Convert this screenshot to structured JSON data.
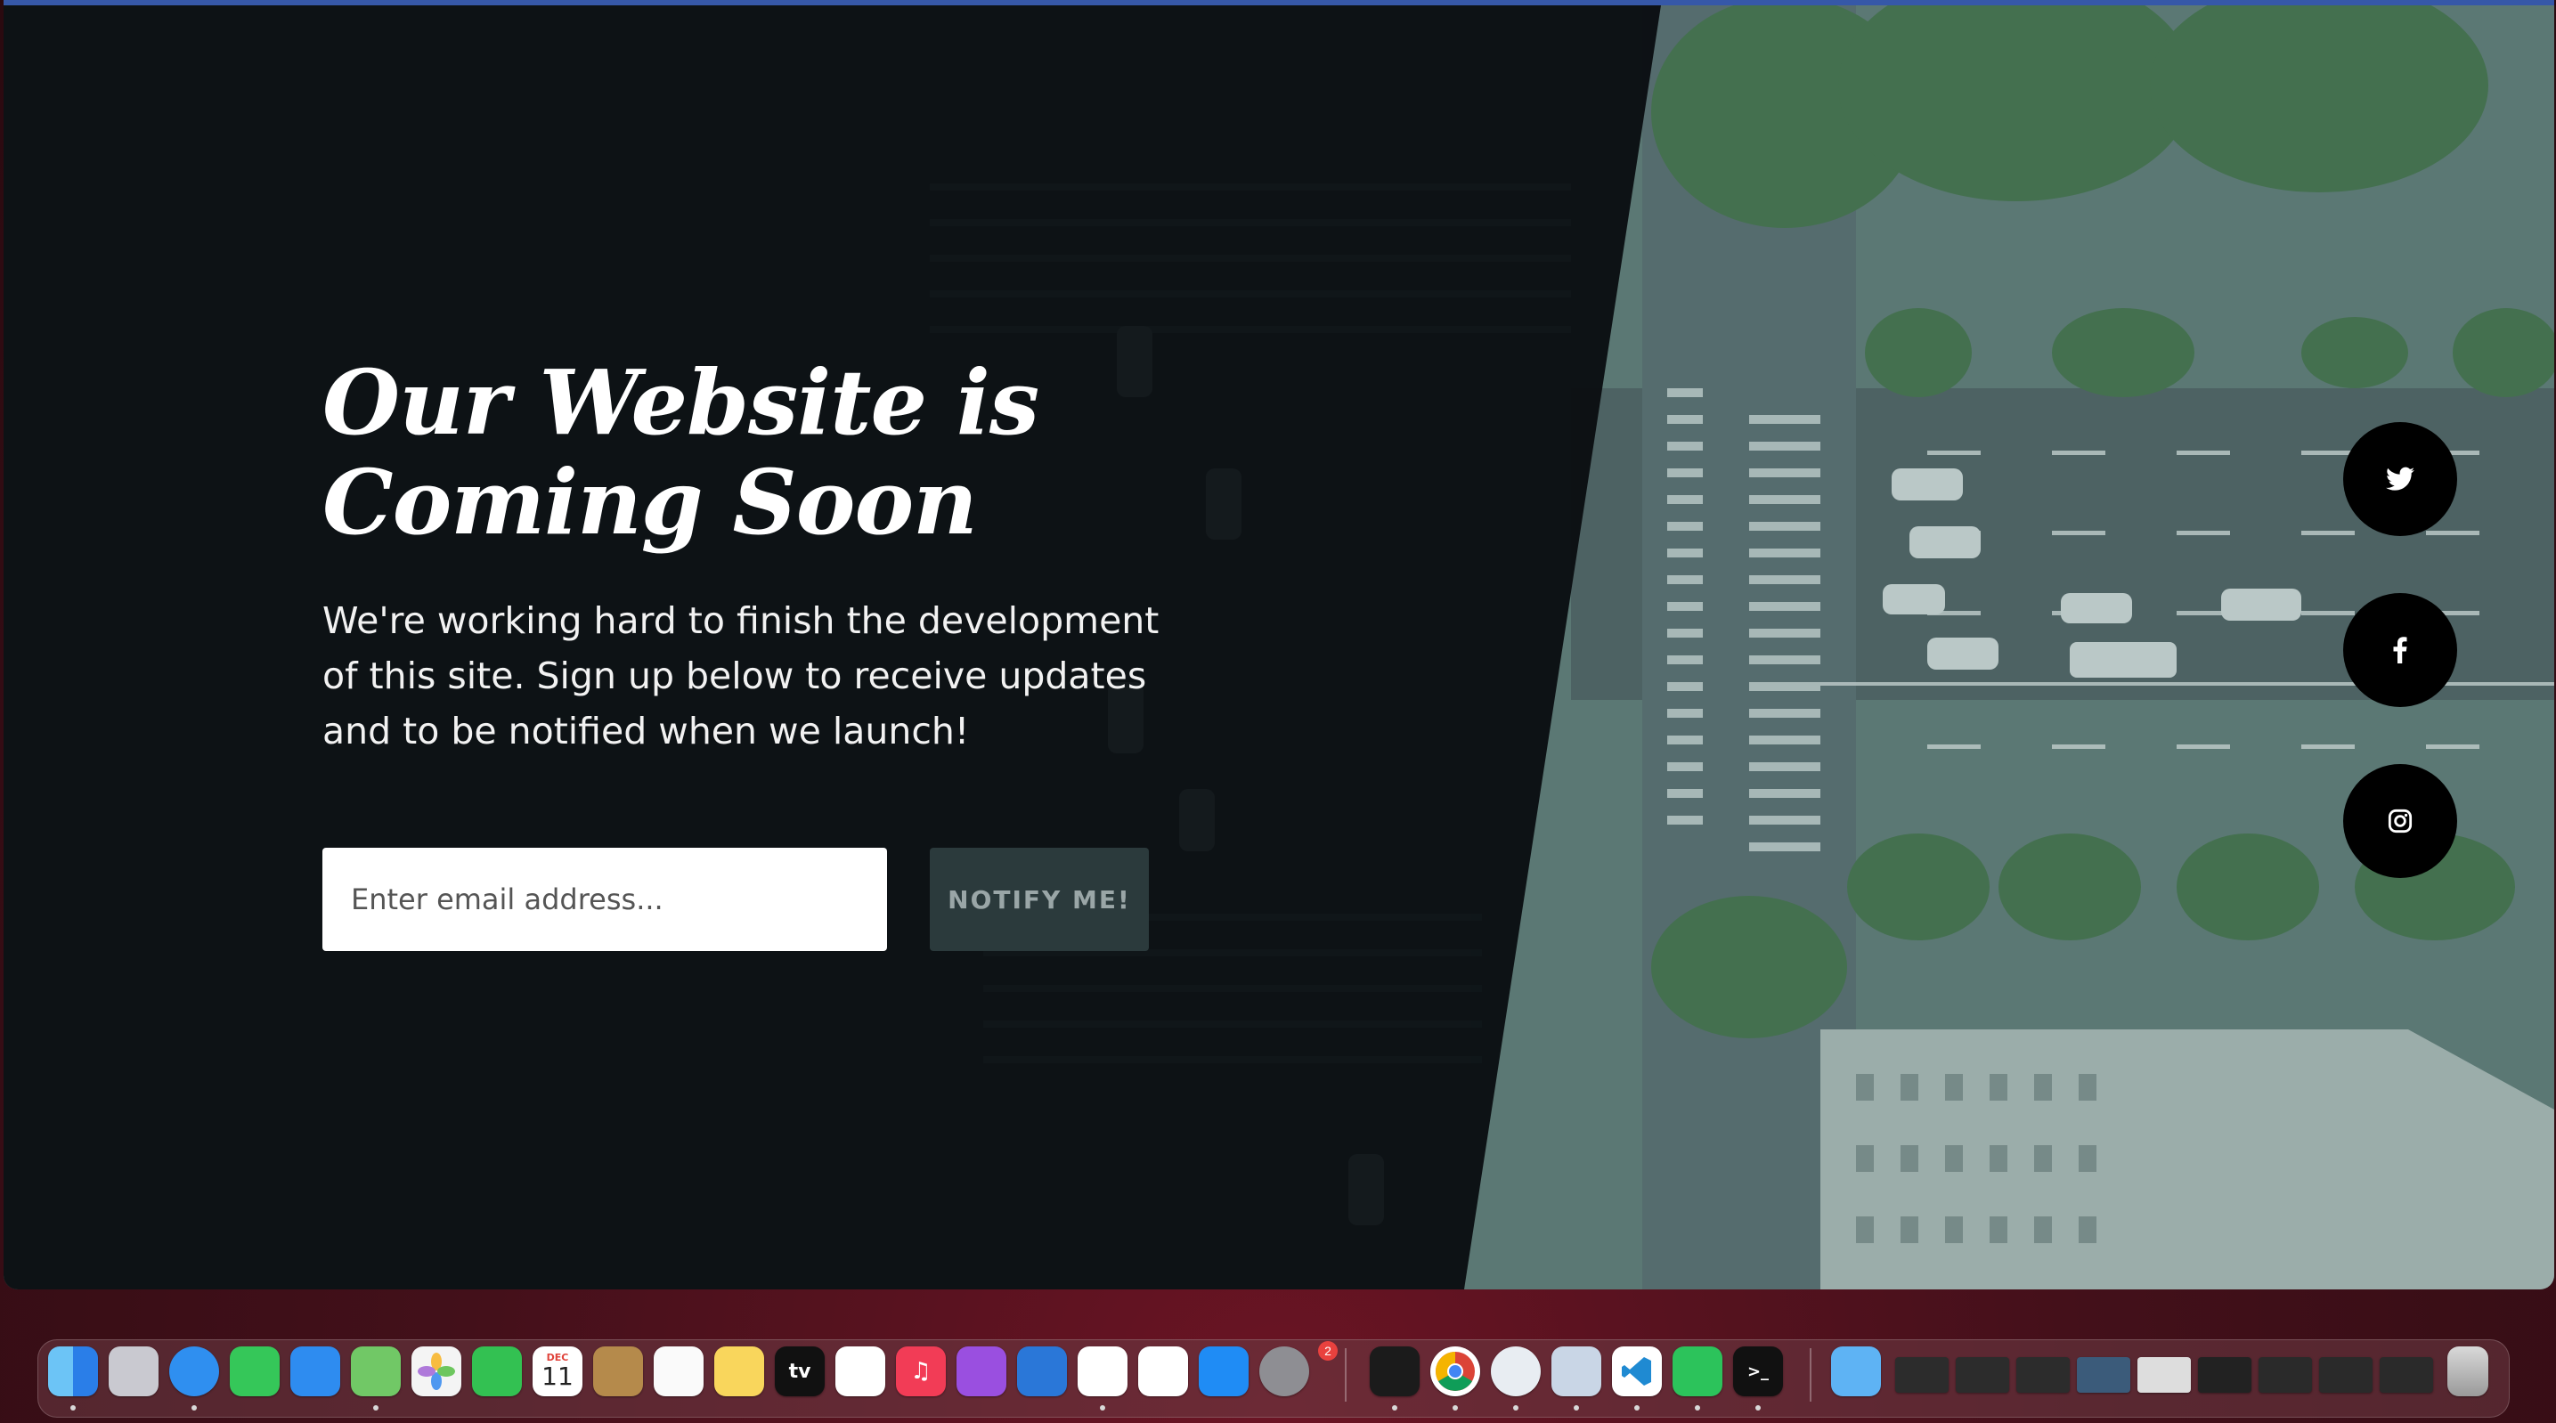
{
  "hero": {
    "headline_line1": "Our Website is",
    "headline_line2": "Coming Soon",
    "description": "We're working hard to finish the development of this site. Sign up below to receive updates and to be notified when we launch!"
  },
  "signup": {
    "email_placeholder": "Enter email address...",
    "button_label": "NOTIFY ME!"
  },
  "social": [
    {
      "name": "twitter-icon"
    },
    {
      "name": "facebook-icon"
    },
    {
      "name": "instagram-icon"
    }
  ],
  "dock": {
    "calendar_month": "DEC",
    "calendar_day": "11",
    "appletv_label": "tv",
    "settings_badge": "2",
    "apps": [
      "finder-icon",
      "launchpad-icon",
      "safari-icon",
      "messages-icon",
      "mail-icon",
      "maps-icon",
      "photos-icon",
      "facetime-icon",
      "calendar-icon",
      "contacts-icon",
      "reminders-icon",
      "notes-icon",
      "appletv-icon",
      "freeform-icon",
      "music-icon",
      "podcasts-icon",
      "keynote-icon",
      "slack-icon",
      "numbers-icon",
      "appstore-icon",
      "system-settings-icon",
      "activity-monitor-icon",
      "chrome-icon",
      "proxyman-icon",
      "preview-icon",
      "vscode-icon",
      "whatsapp-icon",
      "terminal-icon",
      "downloads-folder-icon",
      "trash-icon"
    ]
  },
  "colors": {
    "accent": "#2b3a3c",
    "window_border": "#3658a8",
    "dark_panel": "#0a0d10"
  }
}
